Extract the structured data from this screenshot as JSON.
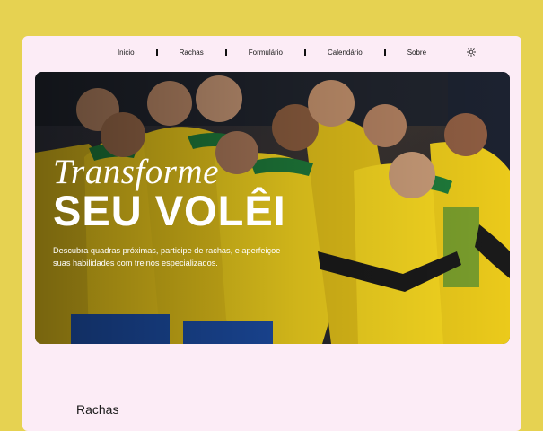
{
  "nav": {
    "items": [
      {
        "label": "Inicio"
      },
      {
        "label": "Rachas"
      },
      {
        "label": "Formulário"
      },
      {
        "label": "Calendário"
      },
      {
        "label": "Sobre"
      }
    ],
    "theme_icon": "sun-icon"
  },
  "hero": {
    "title_line1": "Transforme",
    "title_line2": "SEU VOLÊI",
    "description": "Descubra quadras próximas, participe de rachas, e aperfeiçoe suas habilidades com treinos especializados."
  },
  "sections": {
    "rachas_title": "Rachas"
  },
  "colors": {
    "page_bg": "#e6d251",
    "window_bg": "#fcecf6",
    "text": "#1a1a1a",
    "hero_text": "#ffffff",
    "jersey_yellow": "#f2d21a",
    "jersey_green": "#1e7a3a"
  }
}
